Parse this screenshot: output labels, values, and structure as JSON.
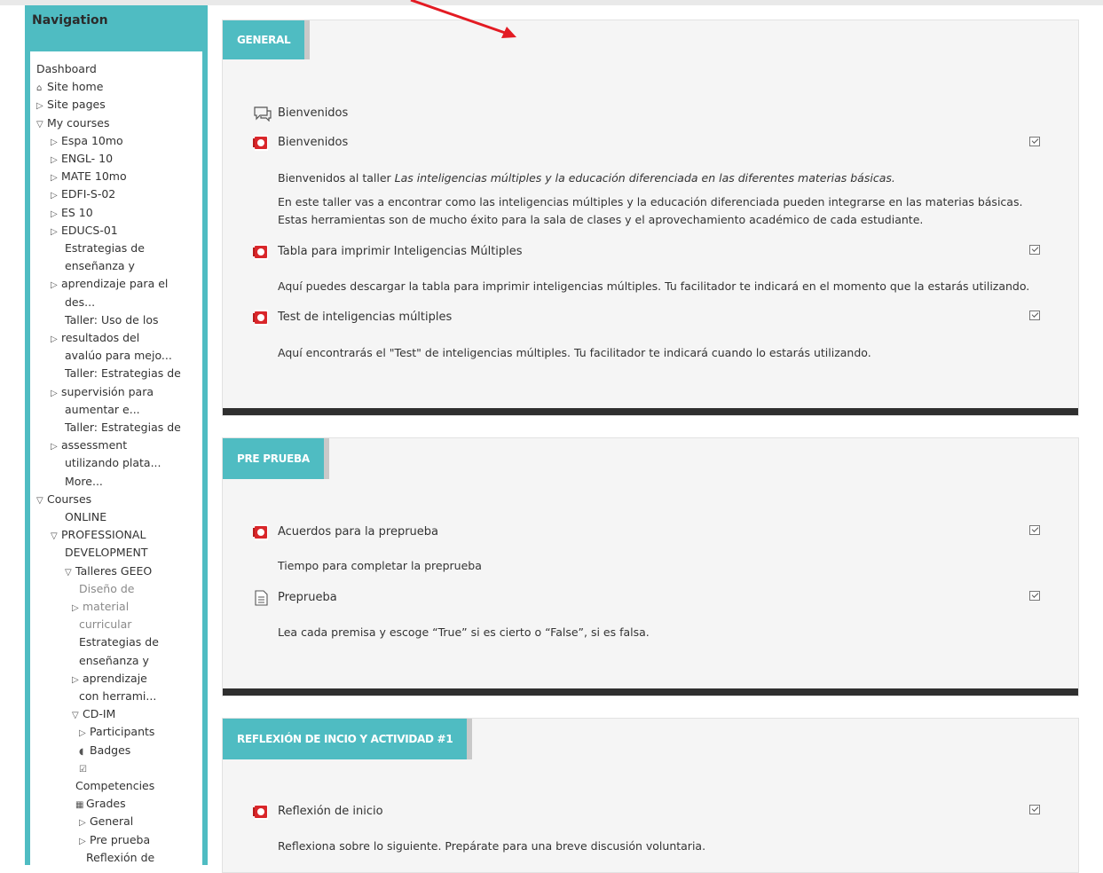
{
  "navigation": {
    "title": "Navigation",
    "rows": [
      {
        "text": "Dashboard",
        "marker": "",
        "indent": 0,
        "dim": false
      },
      {
        "text": "Site home",
        "marker": "home",
        "indent": 0,
        "dim": false
      },
      {
        "text": "Site pages",
        "marker": "closed",
        "indent": 0,
        "dim": false
      },
      {
        "text": "My courses",
        "marker": "open",
        "indent": 0,
        "dim": false
      },
      {
        "text": "Espa 10mo",
        "marker": "closed",
        "indent": 1,
        "dim": false
      },
      {
        "text": "ENGL- 10",
        "marker": "closed",
        "indent": 1,
        "dim": false
      },
      {
        "text": "MATE 10mo",
        "marker": "closed",
        "indent": 1,
        "dim": false
      },
      {
        "text": "EDFI-S-02",
        "marker": "closed",
        "indent": 1,
        "dim": false
      },
      {
        "text": "ES 10",
        "marker": "closed",
        "indent": 1,
        "dim": false
      },
      {
        "text": "EDUCS-01",
        "marker": "closed",
        "indent": 1,
        "dim": false
      },
      {
        "text": "Estrategias de",
        "marker": "",
        "indent": 2,
        "dim": false
      },
      {
        "text": "enseñanza y",
        "marker": "",
        "indent": 2,
        "dim": false
      },
      {
        "text": "aprendizaje para el",
        "marker": "closed",
        "indent": 1,
        "dim": false
      },
      {
        "text": "des...",
        "marker": "",
        "indent": 2,
        "dim": false
      },
      {
        "text": "Taller: Uso de los",
        "marker": "",
        "indent": 2,
        "dim": false
      },
      {
        "text": "resultados del",
        "marker": "closed",
        "indent": 1,
        "dim": false
      },
      {
        "text": "avalúo para mejo...",
        "marker": "",
        "indent": 2,
        "dim": false
      },
      {
        "text": "Taller: Estrategias de",
        "marker": "",
        "indent": 2,
        "dim": false
      },
      {
        "text": "supervisión para",
        "marker": "closed",
        "indent": 1,
        "dim": false
      },
      {
        "text": "aumentar e...",
        "marker": "",
        "indent": 2,
        "dim": false
      },
      {
        "text": "Taller: Estrategias de",
        "marker": "",
        "indent": 2,
        "dim": false
      },
      {
        "text": "assessment",
        "marker": "closed",
        "indent": 1,
        "dim": false
      },
      {
        "text": "utilizando plata...",
        "marker": "",
        "indent": 2,
        "dim": false
      },
      {
        "text": "More...",
        "marker": "",
        "indent": 2,
        "dim": false
      },
      {
        "text": "Courses",
        "marker": "open",
        "indent": 0,
        "dim": false
      },
      {
        "text": "ONLINE",
        "marker": "",
        "indent": 2,
        "dim": false
      },
      {
        "text": "PROFESSIONAL",
        "marker": "open",
        "indent": 1,
        "dim": false
      },
      {
        "text": "DEVELOPMENT",
        "marker": "",
        "indent": 2,
        "dim": false
      },
      {
        "text": "Talleres GEEO",
        "marker": "open",
        "indent": 2,
        "dim": false
      },
      {
        "text": "Diseño de",
        "marker": "",
        "indent": 3,
        "dim": true
      },
      {
        "text": "material",
        "marker": "closed",
        "indent": 2.5,
        "dim": true
      },
      {
        "text": "curricular",
        "marker": "",
        "indent": 3,
        "dim": true
      },
      {
        "text": "Estrategias de",
        "marker": "",
        "indent": 3,
        "dim": false
      },
      {
        "text": "enseñanza y",
        "marker": "",
        "indent": 3,
        "dim": false
      },
      {
        "text": "aprendizaje",
        "marker": "closed",
        "indent": 2.5,
        "dim": false
      },
      {
        "text": "con herrami...",
        "marker": "",
        "indent": 3,
        "dim": false
      },
      {
        "text": "CD-IM",
        "marker": "open",
        "indent": 2.5,
        "dim": false
      },
      {
        "text": "Participants",
        "marker": "closed",
        "indent": 3,
        "dim": false
      },
      {
        "text": "Badges",
        "marker": "badge",
        "indent": 3,
        "dim": false
      },
      {
        "text": "",
        "marker": "check",
        "indent": 3,
        "dim": false
      },
      {
        "text": "Competencies",
        "marker": "",
        "indent": 2.75,
        "dim": false
      },
      {
        "text": "Grades",
        "marker": "grid",
        "indent": 2.75,
        "dim": false
      },
      {
        "text": "General",
        "marker": "closed",
        "indent": 3,
        "dim": false
      },
      {
        "text": "Pre prueba",
        "marker": "closed",
        "indent": 3,
        "dim": false
      },
      {
        "text": "Reflexión de",
        "marker": "",
        "indent": 3.5,
        "dim": false
      }
    ]
  },
  "sections": [
    {
      "tab": "GENERAL",
      "items": [
        {
          "kind": "forum-icon",
          "label": "Bienvenidos",
          "check": false
        },
        {
          "kind": "pdf-icon",
          "label": "Bienvenidos",
          "check": true
        },
        {
          "kind": "desc",
          "label": "Bienvenidos al taller Las inteligencias múltiples y la educación diferenciada en las diferentes materias básicas."
        },
        {
          "kind": "desc",
          "label": "En este taller vas a encontrar como las inteligencias múltiples y la educación diferenciada pueden integrarse en las materias básicas."
        },
        {
          "kind": "desc",
          "label": "Estas herramientas son de mucho éxito para la sala de clases y el aprovechamiento académico de cada estudiante."
        },
        {
          "kind": "pdf-icon",
          "label": "Tabla para imprimir Inteligencias Múltiples",
          "check": true
        },
        {
          "kind": "desc",
          "label": "Aquí puedes descargar la tabla para imprimir inteligencias múltiples.  Tu facilitador te indicará en el momento que la estarás utilizando."
        },
        {
          "kind": "pdf-icon",
          "label": "Test de inteligencias múltiples",
          "check": true
        },
        {
          "kind": "desc",
          "label": "Aquí encontrarás el \"Test\" de inteligencias múltiples.  Tu facilitador te indicará cuando lo estarás utilizando."
        }
      ]
    },
    {
      "tab": "PRE PRUEBA",
      "items": [
        {
          "kind": "pdf-icon",
          "label": "Acuerdos para la preprueba",
          "check": true
        },
        {
          "kind": "desc",
          "label": "Tiempo para completar la preprueba"
        },
        {
          "kind": "quiz-icon",
          "label": "Preprueba",
          "check": true
        },
        {
          "kind": "desc",
          "label": "Lea cada premisa y escoge “True” si es cierto o “False”, si es falsa."
        }
      ]
    },
    {
      "tab": "REFLEXIÓN DE INCIO Y ACTIVIDAD #1",
      "items": [
        {
          "kind": "pdf-icon",
          "label": "Reflexión de inicio",
          "check": true
        },
        {
          "kind": "desc",
          "label": "Reflexiona sobre lo siguiente. Prepárate para una breve discusión voluntaria."
        }
      ]
    }
  ],
  "annotation": {
    "arrow_color": "#e31b23"
  },
  "colors": {
    "accent": "#4fbcc2",
    "pdf": "#d9262a"
  }
}
